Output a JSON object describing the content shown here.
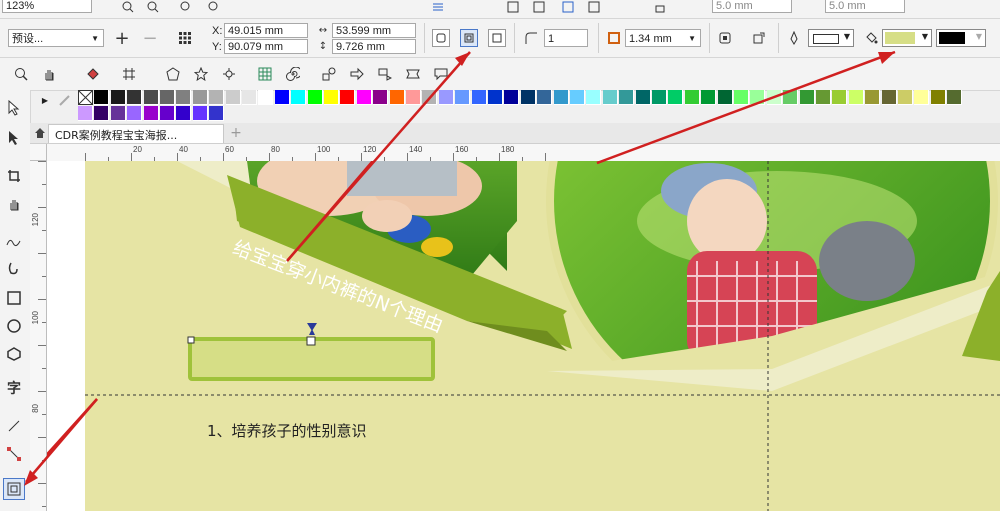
{
  "toolbar1": {
    "zoom_value": "123%",
    "width_value_1": "5.0 mm",
    "width_value_2": "5.0 mm"
  },
  "property_bar": {
    "preset_label": "预设...",
    "x_label": "X:",
    "x_value": "49.015 mm",
    "y_label": "Y:",
    "y_value": "90.079 mm",
    "width_value": "53.599 mm",
    "height_value": "9.726 mm",
    "corner_value": "1",
    "outline_width": "1.34 mm",
    "fill_color": "#d6de86",
    "outline_color": "#000000"
  },
  "palette": {
    "row1": [
      "#ffffff",
      "#000000",
      "#1a1a1a",
      "#333333",
      "#4d4d4d",
      "#666666",
      "#808080",
      "#999999",
      "#b3b3b3",
      "#cccccc",
      "#e6e6e6",
      "#ffffff",
      "#0000ff",
      "#00ffff",
      "#00ff00",
      "#ffff00",
      "#ff0000",
      "#ff00ff",
      "#8b008b",
      "#ff6600",
      "#ff9999",
      "#b3b3b3",
      "#9999ff",
      "#6699ff",
      "#3366ff",
      "#0033cc",
      "#000099",
      "#003366",
      "#336699",
      "#3399cc",
      "#66ccff",
      "#99ffff",
      "#66cccc",
      "#339999",
      "#006666",
      "#009966",
      "#00cc66",
      "#33cc33",
      "#009933",
      "#006633",
      "#66ff66",
      "#99ff99",
      "#ccffcc",
      "#66cc66",
      "#339933",
      "#669933",
      "#99cc33",
      "#ccff66",
      "#999933",
      "#666633",
      "#cccc66",
      "#ffff99",
      "#808000",
      "#556b2f"
    ],
    "row2": [
      "#cc99ff",
      "#330066",
      "#663399",
      "#9966ff",
      "#9900cc",
      "#6600cc",
      "#3300cc",
      "#6633ff",
      "#3333cc"
    ]
  },
  "document": {
    "tab_title": "CDR案例教程宝宝海报...",
    "add_tab": "+"
  },
  "rulers": {
    "h_labels": [
      "20",
      "40",
      "60",
      "80",
      "100",
      "120",
      "140",
      "160",
      "180"
    ],
    "v_labels": [
      "120",
      "100",
      "80"
    ]
  },
  "poster": {
    "banner_text": "给宝宝穿小内裤的N个理由",
    "item_text": "1、培养孩子的性别意识",
    "bg_color": "#e6e4a4",
    "accent_color": "#8cb02a"
  },
  "colors": {
    "annotation_arrow": "#d02020",
    "selected_box_fill": "#d6de86",
    "selected_box_stroke": "#9fc23a"
  }
}
